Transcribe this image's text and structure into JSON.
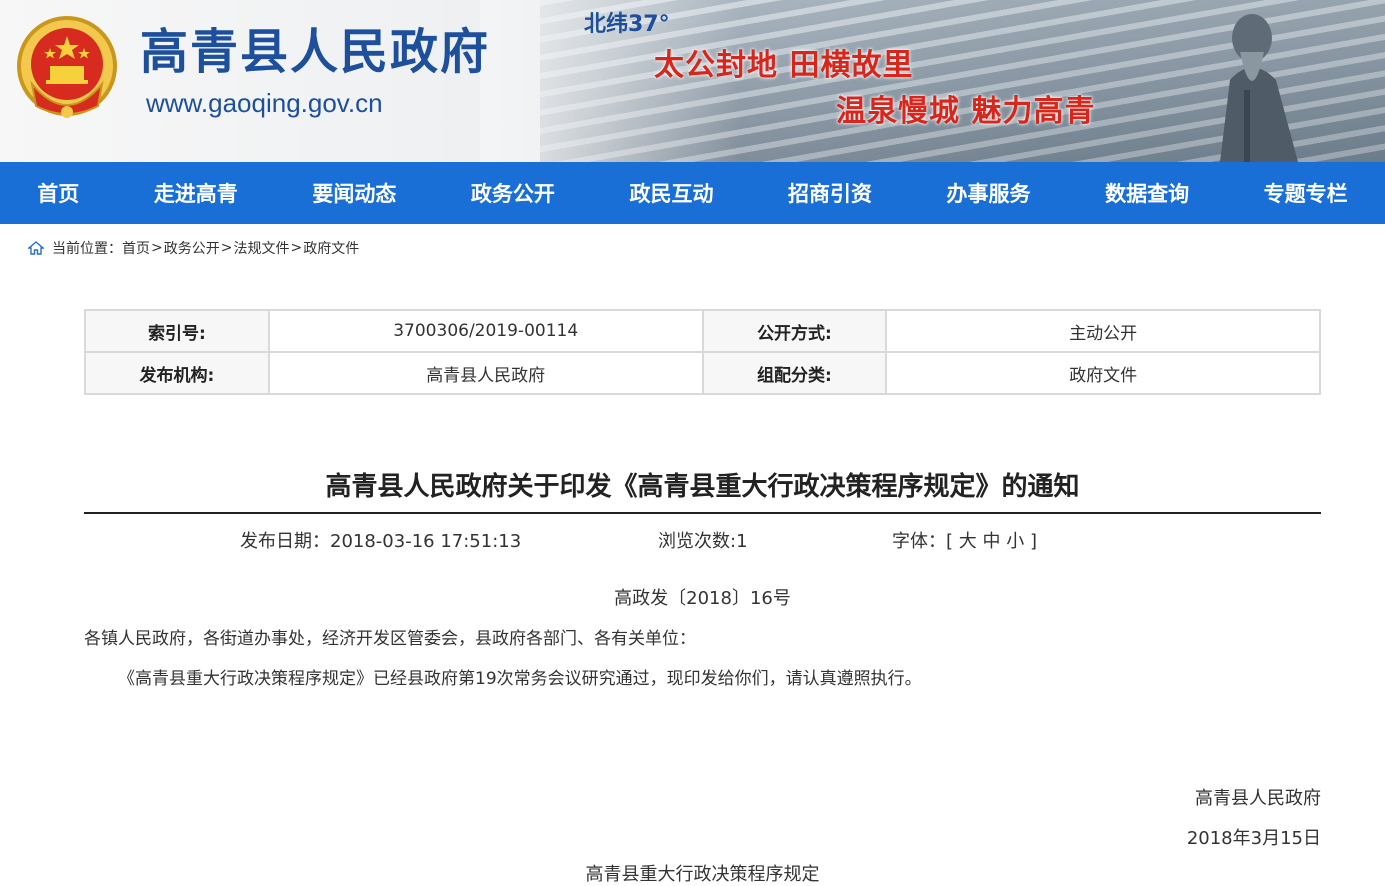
{
  "header": {
    "site_name": "高青县人民政府",
    "site_url": "www.gaoqing.gov.cn",
    "latitude": "北纬37°",
    "slogan_line1": "太公封地  田横故里",
    "slogan_line2": "温泉慢城 魅力高青",
    "emblem_icon": "national-emblem-icon",
    "colors": {
      "brand_blue": "#1d4f9c",
      "slogan_red": "#d7261b",
      "nav_blue": "#1a6fd6"
    }
  },
  "nav": {
    "items": [
      {
        "label": "首页"
      },
      {
        "label": "走进高青"
      },
      {
        "label": "要闻动态"
      },
      {
        "label": "政务公开"
      },
      {
        "label": "政民互动"
      },
      {
        "label": "招商引资"
      },
      {
        "label": "办事服务"
      },
      {
        "label": "数据查询"
      },
      {
        "label": "专题专栏"
      }
    ]
  },
  "breadcrumb": {
    "prefix": "当前位置：",
    "items": [
      "首页",
      "政务公开",
      "法规文件",
      "政府文件"
    ],
    "separator": ">",
    "icon": "home-icon"
  },
  "meta": {
    "index_label": "索引号:",
    "index_value": "3700306/2019-00114",
    "public_label": "公开方式:",
    "public_value": "主动公开",
    "publisher_label": "发布机构:",
    "publisher_value": "高青县人民政府",
    "category_label": "组配分类:",
    "category_value": "政府文件"
  },
  "article": {
    "title": "高青县人民政府关于印发《高青县重大行政决策程序规定》的通知",
    "publish_date": "发布日期：2018-03-16 17:51:13",
    "views": "浏览次数:1",
    "font_prefix": "字体：[",
    "font_large": "大",
    "font_medium": "中",
    "font_small": "小",
    "font_suffix": "]",
    "doc_number": "高政发〔2018〕16号",
    "recipients": "各镇人民政府，各街道办事处，经济开发区管委会，县政府各部门、各有关单位：",
    "body": "《高青县重大行政决策程序规定》已经县政府第19次常务会议研究通过，现印发给你们，请认真遵照执行。",
    "signature": "高青县人民政府",
    "sign_date": "2018年3月15日",
    "attachment_title": "高青县重大行政决策程序规定"
  }
}
